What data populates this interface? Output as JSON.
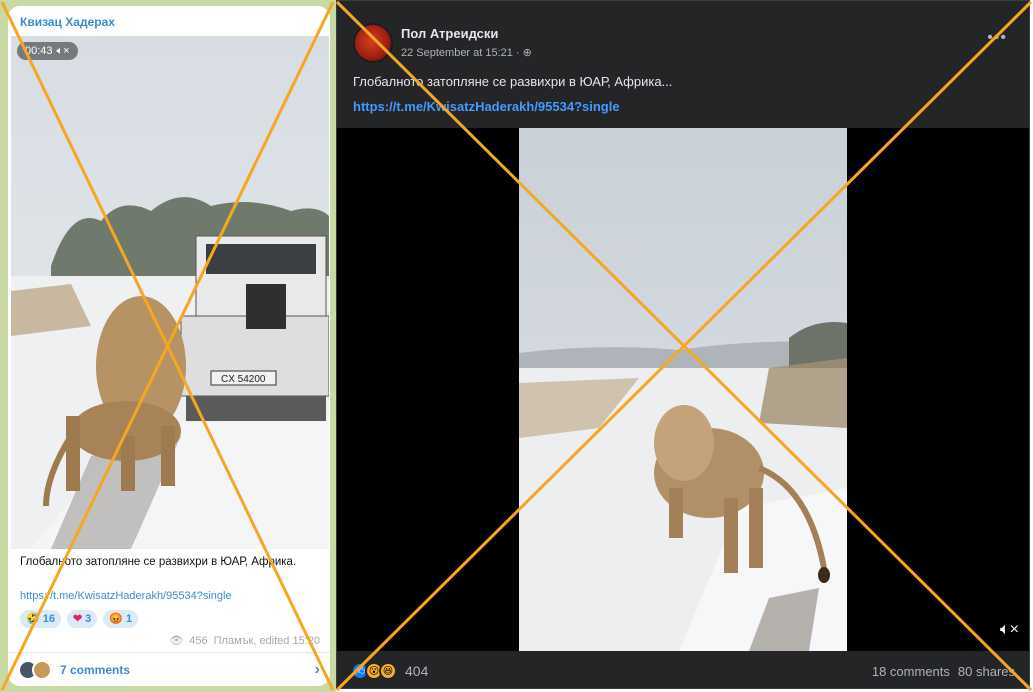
{
  "telegram": {
    "channel_name": "Квизац Хадерах",
    "timer": "00:43",
    "caption": "Глобалното затопляне се развихри в ЮАР, Африка.",
    "link": "https://t.me/KwisatzHaderakh/95534?single",
    "reactions": [
      {
        "emoji": "🤣",
        "count": "16"
      },
      {
        "emoji": "❤",
        "count": "3"
      },
      {
        "emoji": "😡",
        "count": "1"
      }
    ],
    "views": "456",
    "meta": "Пламък, edited 15:20",
    "comments_label": "7 comments",
    "plate": "CX 54200"
  },
  "facebook": {
    "author": "Пол Атреидски",
    "date": "22 September at 15:21 ·",
    "post_text": "Глобалното затопляне се развихри в ЮАР, Африка...",
    "link": "https://t.me/KwisatzHaderakh/95534?single",
    "reactions_count": "404",
    "comments": "18 comments",
    "shares": "80 shares"
  },
  "colors": {
    "overlay_x": "#f5a623",
    "telegram_link": "#3a8ccf",
    "facebook_link": "#4599ff",
    "facebook_bg": "#242526"
  }
}
